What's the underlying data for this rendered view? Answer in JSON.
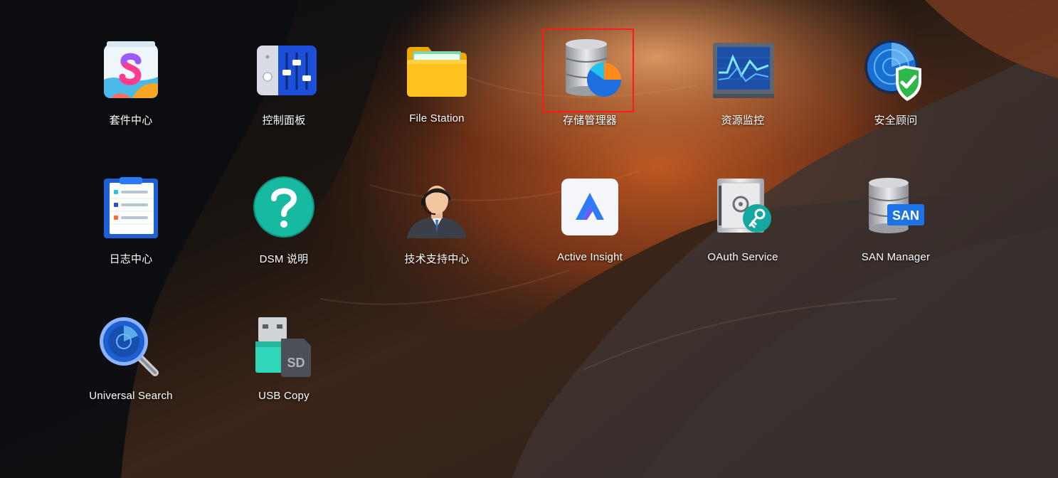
{
  "desktop": {
    "apps": [
      {
        "id": "package-center",
        "label": "套件中心",
        "icon": "package-center-icon"
      },
      {
        "id": "control-panel",
        "label": "控制面板",
        "icon": "control-panel-icon"
      },
      {
        "id": "file-station",
        "label": "File Station",
        "icon": "folder-icon"
      },
      {
        "id": "storage-manager",
        "label": "存储管理器",
        "icon": "storage-manager-icon"
      },
      {
        "id": "resource-monitor",
        "label": "资源监控",
        "icon": "resource-monitor-icon"
      },
      {
        "id": "security-advisor",
        "label": "安全顾问",
        "icon": "security-advisor-icon"
      },
      {
        "id": "log-center",
        "label": "日志中心",
        "icon": "log-center-icon"
      },
      {
        "id": "dsm-help",
        "label": "DSM 说明",
        "icon": "help-icon"
      },
      {
        "id": "support-center",
        "label": "技术支持中心",
        "icon": "support-agent-icon"
      },
      {
        "id": "active-insight",
        "label": "Active Insight",
        "icon": "active-insight-icon"
      },
      {
        "id": "oauth-service",
        "label": "OAuth Service",
        "icon": "oauth-safe-icon"
      },
      {
        "id": "san-manager",
        "label": "SAN Manager",
        "icon": "san-manager-icon"
      },
      {
        "id": "universal-search",
        "label": "Universal Search",
        "icon": "magnifier-icon"
      },
      {
        "id": "usb-copy",
        "label": "USB Copy",
        "icon": "usb-copy-icon"
      }
    ],
    "highlighted_app": "storage-manager",
    "highlight_color": "#ff1a1a"
  },
  "icons": {
    "san_badge_text": "SAN",
    "sd_badge_text": "SD"
  }
}
